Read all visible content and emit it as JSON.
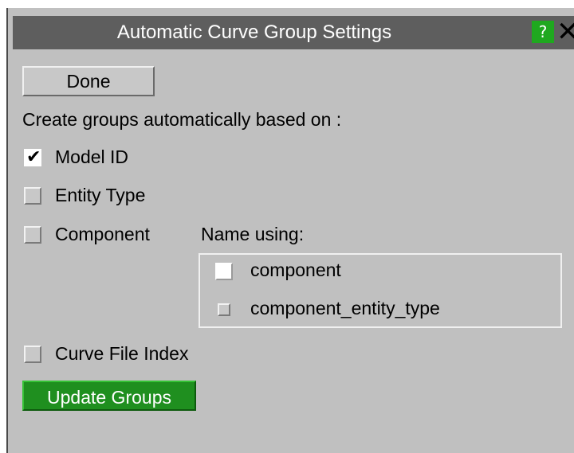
{
  "window": {
    "title": "Automatic Curve Group Settings",
    "help_label": "?",
    "close_label": "✕"
  },
  "actions": {
    "done_label": "Done",
    "update_label": "Update Groups"
  },
  "prompt": "Create groups automatically based on :",
  "options": [
    {
      "label": "Model ID",
      "checked": true
    },
    {
      "label": "Entity Type",
      "checked": false
    },
    {
      "label": "Component",
      "checked": false
    },
    {
      "label": "Curve File Index",
      "checked": false
    }
  ],
  "name_using": {
    "label": "Name using:",
    "choices": [
      {
        "label": "component",
        "selected": true
      },
      {
        "label": "component_entity_type",
        "selected": false
      }
    ]
  },
  "colors": {
    "titlebar": "#5e5e5e",
    "panel": "#c0c0c0",
    "accent_green": "#1f8f1f"
  }
}
